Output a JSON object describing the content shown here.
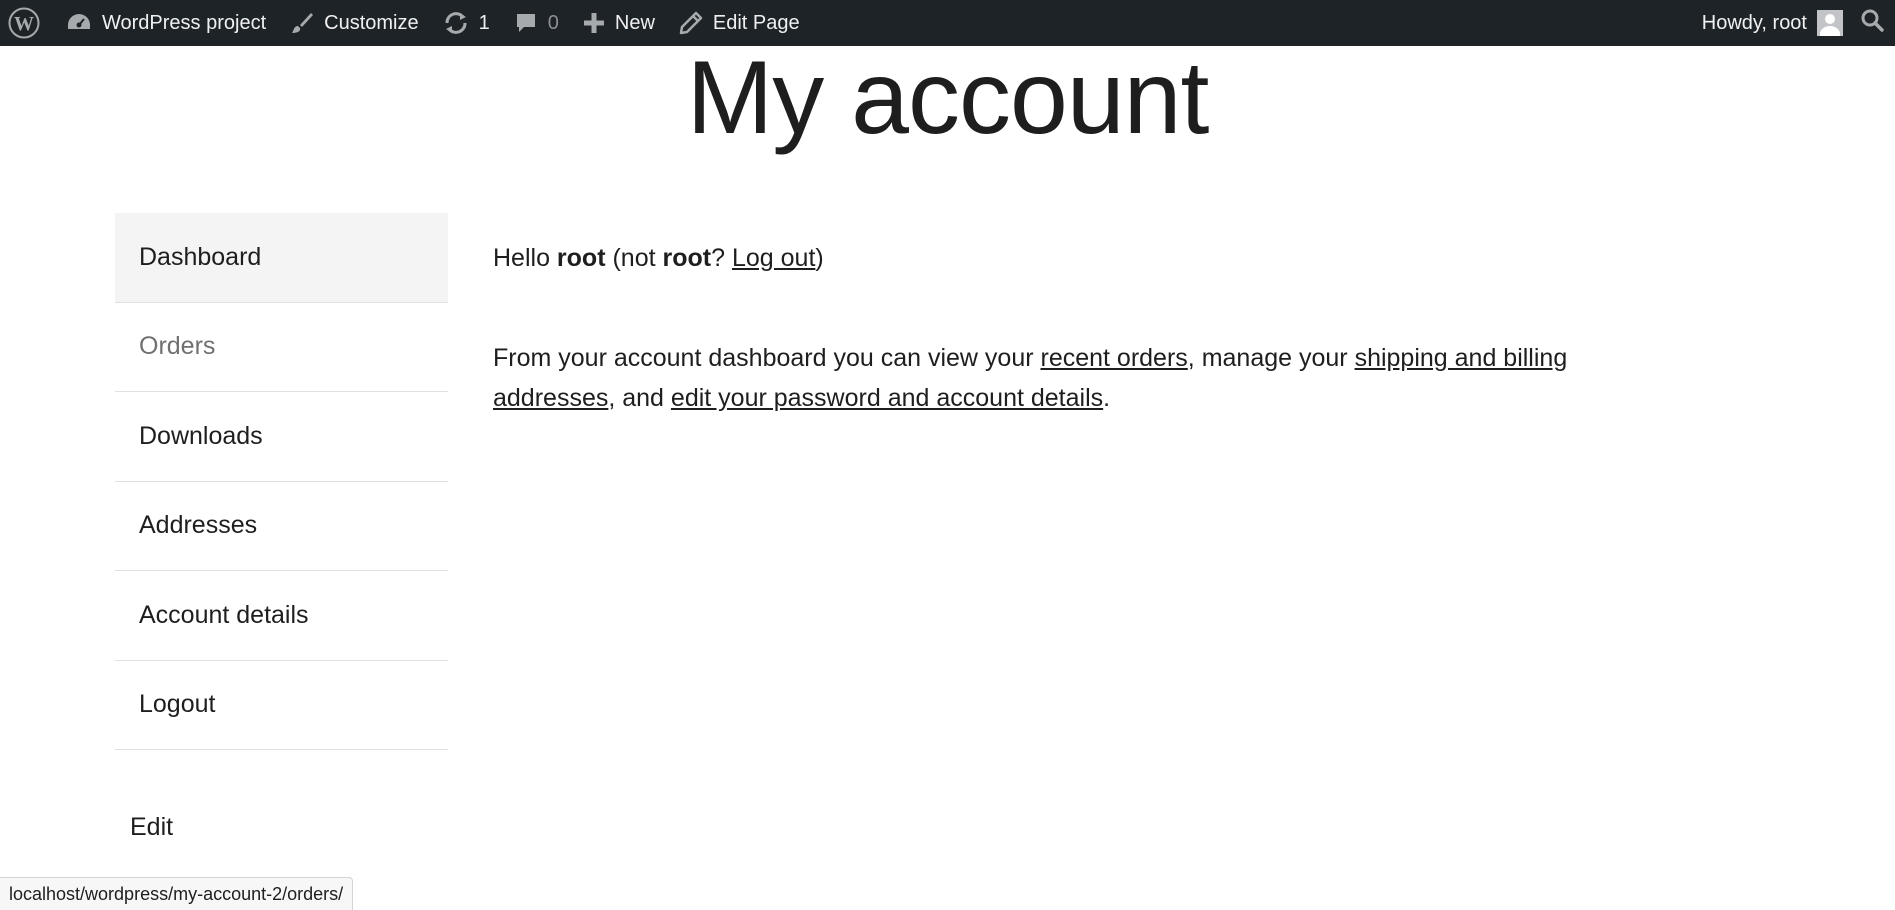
{
  "adminbar": {
    "site_name": "WordPress project",
    "customize_label": "Customize",
    "updates_count": "1",
    "comments_count": "0",
    "new_label": "New",
    "edit_page_label": "Edit Page",
    "howdy_label": "Howdy, root",
    "icons": [
      "wordpress-logo-icon",
      "dashboard-icon",
      "brush-icon",
      "updates-icon",
      "comment-icon",
      "plus-icon",
      "pencil-icon",
      "search-icon"
    ]
  },
  "page": {
    "title": "My account"
  },
  "account_nav": {
    "items": [
      {
        "label": "Dashboard",
        "state": "active"
      },
      {
        "label": "Orders",
        "state": "hover"
      },
      {
        "label": "Downloads"
      },
      {
        "label": "Addresses"
      },
      {
        "label": "Account details"
      },
      {
        "label": "Logout"
      }
    ]
  },
  "content": {
    "hello_prefix": "Hello ",
    "username": "root",
    "not_prefix": " (not ",
    "username_again": "root",
    "question": "? ",
    "logout_link": "Log out",
    "close_paren": ")",
    "dashboard_intro": "From your account dashboard you can view your ",
    "recent_orders_link": "recent orders",
    "manage_text": ", manage your ",
    "addresses_link": "shipping and billing addresses",
    "and_text": ", and ",
    "account_details_link": "edit your password and account details",
    "period": "."
  },
  "edit_link": "Edit",
  "status_bar": {
    "url": "localhost/wordpress/my-account-2/orders/"
  },
  "colors": {
    "adminbar_bg": "#1d2327",
    "adminbar_text": "#f0f0f1",
    "active_nav_bg": "#f4f4f4",
    "text": "#1e1e1e"
  }
}
